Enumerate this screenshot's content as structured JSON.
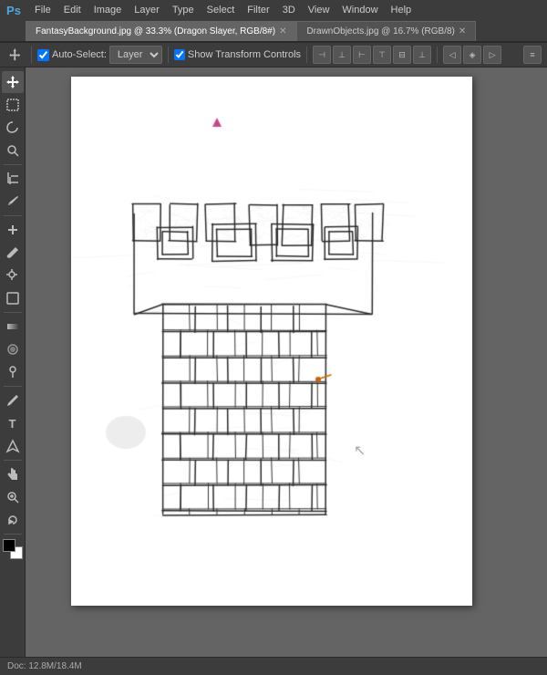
{
  "menubar": {
    "logo": "Ps",
    "items": [
      "File",
      "Edit",
      "Image",
      "Layer",
      "Type",
      "Select",
      "Filter",
      "3D",
      "View",
      "Window",
      "Help"
    ]
  },
  "toolbar": {
    "auto_select_label": "Auto-Select:",
    "layer_dropdown": "Layer",
    "show_transform_label": "Show Transform Controls",
    "align_buttons": [
      "◧",
      "⊟",
      "◨",
      "⊤",
      "⊟",
      "⊥",
      "◁",
      "▷"
    ],
    "more_btn": "≡"
  },
  "tabs": [
    {
      "label": "FantasyBackground.jpg @ 33.3% (Dragon Slayer, RGB/8#)",
      "active": true,
      "modified": true
    },
    {
      "label": "DrawnObjects.jpg @ 16.7% (RGB/8)",
      "active": false,
      "modified": false
    }
  ],
  "tools": [
    {
      "name": "move-tool",
      "icon": "✛",
      "active": true
    },
    {
      "name": "selection-tool",
      "icon": "⬚"
    },
    {
      "name": "lasso-tool",
      "icon": "⟳"
    },
    {
      "name": "quick-select-tool",
      "icon": "⚡"
    },
    {
      "name": "crop-tool",
      "icon": "⌗"
    },
    {
      "name": "eyedropper-tool",
      "icon": "✒"
    },
    {
      "name": "heal-tool",
      "icon": "✚"
    },
    {
      "name": "brush-tool",
      "icon": "✏"
    },
    {
      "name": "clone-tool",
      "icon": "🖇"
    },
    {
      "name": "eraser-tool",
      "icon": "◻"
    },
    {
      "name": "gradient-tool",
      "icon": "▣"
    },
    {
      "name": "blur-tool",
      "icon": "⊙"
    },
    {
      "name": "dodge-tool",
      "icon": "◯"
    },
    {
      "name": "pen-tool",
      "icon": "⌒"
    },
    {
      "name": "type-tool",
      "icon": "T"
    },
    {
      "name": "path-select-tool",
      "icon": "⊿"
    },
    {
      "name": "shape-tool",
      "icon": "○"
    },
    {
      "name": "hand-tool",
      "icon": "✋"
    },
    {
      "name": "zoom-tool",
      "icon": "⌕"
    },
    {
      "name": "rotate-tool",
      "icon": "↺"
    }
  ],
  "canvas": {
    "background": "#ffffff",
    "drawing_description": "Hand-drawn castle tower pencil sketch"
  },
  "statusbar": {
    "doc_size": "Doc: 12.8M/18.4M"
  }
}
